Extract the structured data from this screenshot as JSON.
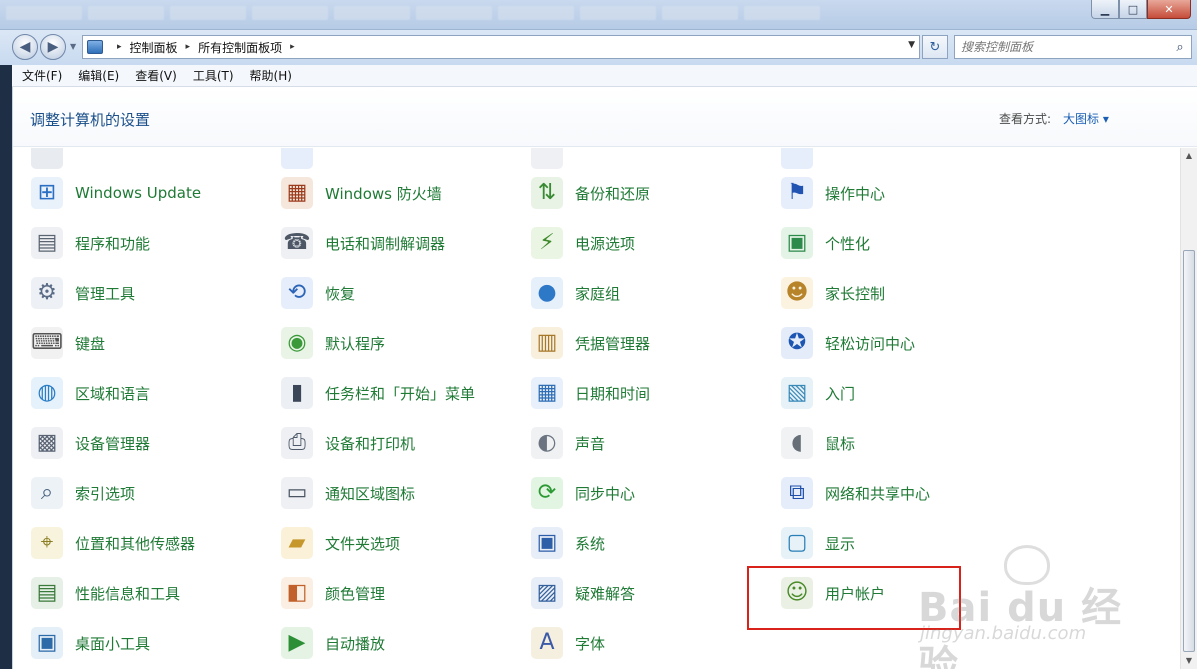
{
  "window": {
    "minimize_glyph": "▁",
    "maximize_glyph": "□",
    "close_glyph": "✕"
  },
  "nav": {
    "back_icon": "arrow-left-icon",
    "forward_icon": "arrow-right-icon",
    "back_glyph": "◀",
    "forward_glyph": "▶"
  },
  "address": {
    "crumbs": [
      "控制面板",
      "所有控制面板项"
    ],
    "crumb_sep": "▸",
    "dropdown_glyph": "▼",
    "refresh_glyph": "↻"
  },
  "search": {
    "placeholder": "搜索控制面板",
    "icon_glyph": "⌕"
  },
  "menu": [
    "文件(F)",
    "编辑(E)",
    "查看(V)",
    "工具(T)",
    "帮助(H)"
  ],
  "header": {
    "title": "调整计算机的设置",
    "view_label": "查看方式:",
    "view_value": "大图标 ▾"
  },
  "colors": {
    "link_green": "#1f7a35",
    "title_blue": "#1b4f8a",
    "highlight_red": "#d9231a"
  },
  "items": [
    {
      "label": "Windows Update",
      "icon": "windows-update-icon",
      "glyph": "⊞",
      "bg": "#e9f1fb",
      "fg": "#2a6fc2"
    },
    {
      "label": "Windows 防火墙",
      "icon": "firewall-icon",
      "glyph": "▦",
      "bg": "#f6e7dc",
      "fg": "#9b3b1c"
    },
    {
      "label": "备份和还原",
      "icon": "backup-restore-icon",
      "glyph": "⇅",
      "bg": "#e8f3e6",
      "fg": "#3a8a33"
    },
    {
      "label": "操作中心",
      "icon": "action-center-flag-icon",
      "glyph": "⚑",
      "bg": "#e7eefb",
      "fg": "#2153b3"
    },
    {
      "label": "程序和功能",
      "icon": "programs-features-icon",
      "glyph": "▤",
      "bg": "#eef0f3",
      "fg": "#5b6472"
    },
    {
      "label": "电话和调制解调器",
      "icon": "phone-modem-icon",
      "glyph": "☎",
      "bg": "#eef0f3",
      "fg": "#4d5765"
    },
    {
      "label": "电源选项",
      "icon": "power-options-icon",
      "glyph": "⚡",
      "bg": "#eaf5e4",
      "fg": "#3e8a2a"
    },
    {
      "label": "个性化",
      "icon": "personalization-icon",
      "glyph": "▣",
      "bg": "#e3f3e6",
      "fg": "#2c8a4a"
    },
    {
      "label": "管理工具",
      "icon": "admin-tools-icon",
      "glyph": "⚙",
      "bg": "#edf1f6",
      "fg": "#5a6c86"
    },
    {
      "label": "恢复",
      "icon": "recovery-icon",
      "glyph": "⟲",
      "bg": "#e7eefb",
      "fg": "#2c64b8"
    },
    {
      "label": "家庭组",
      "icon": "homegroup-icon",
      "glyph": "●",
      "bg": "#e6f0fb",
      "fg": "#2e78c8"
    },
    {
      "label": "家长控制",
      "icon": "parental-controls-icon",
      "glyph": "☻",
      "bg": "#fbf2e0",
      "fg": "#b7842a"
    },
    {
      "label": "键盘",
      "icon": "keyboard-icon",
      "glyph": "⌨",
      "bg": "#f1f1f1",
      "fg": "#555555"
    },
    {
      "label": "默认程序",
      "icon": "default-programs-icon",
      "glyph": "◉",
      "bg": "#eaf4e6",
      "fg": "#3a9a3a"
    },
    {
      "label": "凭据管理器",
      "icon": "credential-manager-icon",
      "glyph": "▥",
      "bg": "#f8efdc",
      "fg": "#a7782a"
    },
    {
      "label": "轻松访问中心",
      "icon": "ease-of-access-icon",
      "glyph": "✪",
      "bg": "#e4ecfa",
      "fg": "#1d56b2"
    },
    {
      "label": "区域和语言",
      "icon": "region-language-icon",
      "glyph": "◍",
      "bg": "#e5f1fb",
      "fg": "#2b7dc4"
    },
    {
      "label": "任务栏和「开始」菜单",
      "icon": "taskbar-start-menu-icon",
      "glyph": "▮",
      "bg": "#eceff3",
      "fg": "#3b4658"
    },
    {
      "label": "日期和时间",
      "icon": "date-time-icon",
      "glyph": "▦",
      "bg": "#e7f0fb",
      "fg": "#2f6db5"
    },
    {
      "label": "入门",
      "icon": "getting-started-icon",
      "glyph": "▧",
      "bg": "#e6f1f8",
      "fg": "#3a8ab8"
    },
    {
      "label": "设备管理器",
      "icon": "device-manager-icon",
      "glyph": "▩",
      "bg": "#eef0f3",
      "fg": "#596373"
    },
    {
      "label": "设备和打印机",
      "icon": "devices-printers-icon",
      "glyph": "⎙",
      "bg": "#eef0f3",
      "fg": "#4f5a6a"
    },
    {
      "label": "声音",
      "icon": "sound-icon",
      "glyph": "◐",
      "bg": "#eff1f3",
      "fg": "#6b7480"
    },
    {
      "label": "鼠标",
      "icon": "mouse-icon",
      "glyph": "◖",
      "bg": "#f1f2f4",
      "fg": "#666e78"
    },
    {
      "label": "索引选项",
      "icon": "indexing-options-icon",
      "glyph": "⌕",
      "bg": "#edf2f7",
      "fg": "#4c6480"
    },
    {
      "label": "通知区域图标",
      "icon": "notification-area-icon",
      "glyph": "▭",
      "bg": "#eef0f3",
      "fg": "#4a5463"
    },
    {
      "label": "同步中心",
      "icon": "sync-center-icon",
      "glyph": "⟳",
      "bg": "#e2f4e2",
      "fg": "#2c9a34"
    },
    {
      "label": "网络和共享中心",
      "icon": "network-sharing-icon",
      "glyph": "⧉",
      "bg": "#e5edfb",
      "fg": "#1f4fa8"
    },
    {
      "label": "位置和其他传感器",
      "icon": "location-sensors-icon",
      "glyph": "⌖",
      "bg": "#f7f3dc",
      "fg": "#8a7d22"
    },
    {
      "label": "文件夹选项",
      "icon": "folder-options-icon",
      "glyph": "▰",
      "bg": "#fbf1d9",
      "fg": "#c6982c"
    },
    {
      "label": "系统",
      "icon": "system-icon",
      "glyph": "▣",
      "bg": "#e8eef8",
      "fg": "#2d5ea8"
    },
    {
      "label": "显示",
      "icon": "display-icon",
      "glyph": "▢",
      "bg": "#e6f1f8",
      "fg": "#2a7fb6"
    },
    {
      "label": "性能信息和工具",
      "icon": "performance-tools-icon",
      "glyph": "▤",
      "bg": "#e6f0e6",
      "fg": "#3a7a3a"
    },
    {
      "label": "颜色管理",
      "icon": "color-management-icon",
      "glyph": "◧",
      "bg": "#fbeee2",
      "fg": "#c1602a"
    },
    {
      "label": "疑难解答",
      "icon": "troubleshooting-icon",
      "glyph": "▨",
      "bg": "#e7eef8",
      "fg": "#335f9a"
    },
    {
      "label": "用户帐户",
      "icon": "user-accounts-icon",
      "glyph": "☺",
      "bg": "#eaf1e4",
      "fg": "#4a8a2a"
    },
    {
      "label": "桌面小工具",
      "icon": "desktop-gadgets-icon",
      "glyph": "▣",
      "bg": "#e5eff8",
      "fg": "#2c6aa8"
    },
    {
      "label": "自动播放",
      "icon": "autoplay-icon",
      "glyph": "▶",
      "bg": "#e4f3e4",
      "fg": "#2d8f35"
    },
    {
      "label": "字体",
      "icon": "fonts-icon",
      "glyph": "A",
      "bg": "#f5efe0",
      "fg": "#3b5aa8"
    }
  ],
  "watermark": {
    "brand": "Bai du 经验",
    "url": "jingyan.baidu.com"
  }
}
